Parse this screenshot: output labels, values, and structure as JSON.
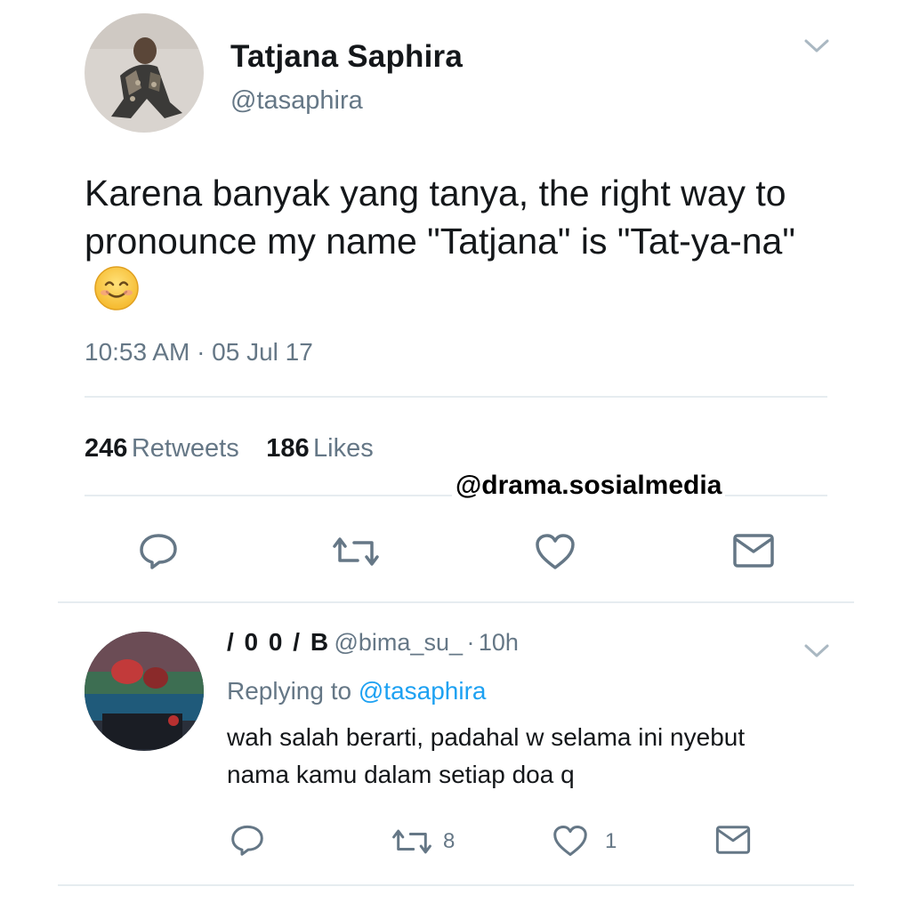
{
  "tweet": {
    "author_name": "Tatjana Saphira",
    "author_handle": "@tasaphira",
    "text": "Karena banyak yang tanya, the right way to pronounce my name \"Tatjana\" is \"Tat-ya-na\"",
    "emoji": "smiling-face-icon",
    "timestamp": "10:53 AM · 05 Jul 17",
    "retweets_count": "246",
    "retweets_label": "Retweets",
    "likes_count": "186",
    "likes_label": "Likes",
    "actions": [
      "reply-icon",
      "retweet-icon",
      "heart-icon",
      "message-icon"
    ]
  },
  "watermark": "@drama.sosialmedia",
  "reply": {
    "author_name": "/ 0 0 / B",
    "author_handle": "@bima_su_",
    "separator": "·",
    "time": "10h",
    "replying_prefix": "Replying to",
    "replying_to": "@tasaphira",
    "text_line1": "wah salah berarti, padahal w selama ini nyebut",
    "text_line2": "nama kamu dalam setiap doa q",
    "retweet_count": "8",
    "like_count": "1"
  },
  "colors": {
    "primary_text": "#14171a",
    "secondary_text": "#657786",
    "link": "#1da1f2",
    "divider": "#e6ecf0"
  }
}
